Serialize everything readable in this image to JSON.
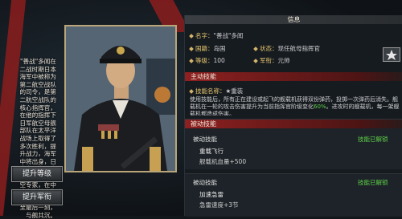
{
  "lore": "\"善战\"多闻在二战时期日本海军中被称为第二航空战队的司令，是第二航空战队的核心指挥官，在他的指挥下日军航空母舰部队在太平洋战场上取得了多次胜利，提升战力，海军中将出身，日本帝国海军中为数不多的航空专家，在中途岛海战中指挥飞龙号奋战至最后一刻，与舰共沉。",
  "buttons": {
    "level_up": "提升等级",
    "rank_up": "提升军衔"
  },
  "info": {
    "header": "信息",
    "name_label": "名字：",
    "name_value": "\"善战\"多闻",
    "country_label": "国籍：",
    "country_value": "岛国",
    "status_label": "状态：",
    "status_value": "现任航母指挥官",
    "level_label": "等级：",
    "level_value": "100",
    "rank_label": "军衔：",
    "rank_value": "元帅"
  },
  "active_skill": {
    "header": "主动技能",
    "name_label": "技能名称：",
    "name_value": "★重装",
    "desc_prefix": "使用技能后，所有正在建设或起飞的舰载机获得双份弹药，投掷一次弹药后消失。舰载机在一轮的攻击伤害提升为当前指挥官阶级变化",
    "desc_highlight": "60%",
    "desc_suffix": "。进攻时的舰载机，每一架舰载机都造成伤害。"
  },
  "passive_skills": [
    {
      "header": "被动技能",
      "status": "技能已解锁",
      "name": "重载飞行",
      "effect": "舰载机血量+500"
    },
    {
      "header": "被动技能",
      "status": "技能已解锁",
      "name": "加速急雷",
      "effect": "急雷速度+3节"
    }
  ],
  "colors": {
    "accent_red": "#8e2020",
    "unlock_green": "#5fd14a",
    "gold": "#e9c86f"
  }
}
